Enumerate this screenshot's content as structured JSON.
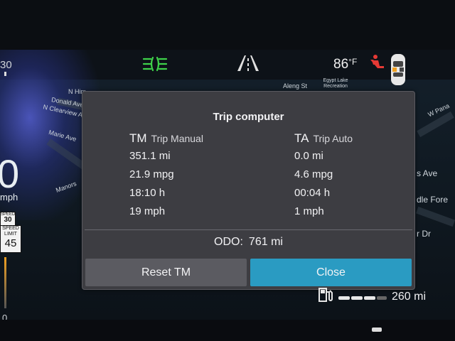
{
  "status": {
    "time_partial": "30",
    "temperature_value": "86",
    "temperature_unit": "°F"
  },
  "map": {
    "streets": [
      "N Him",
      "Donald Ave",
      "N Clearview Ave",
      "Marie Ave",
      "Manors",
      "Aleng St",
      "Egypt Lake Recreation",
      "W Pana",
      "s Ave",
      "dle Fore",
      "r Dr"
    ]
  },
  "left_cluster": {
    "speed_value": "0",
    "speed_unit": "mph",
    "sign_speed_label": "SPEED",
    "sign_speed_value": "30",
    "sign_limit_top": "SPEED",
    "sign_limit_mid": "LIMIT",
    "sign_limit_value": "45",
    "bottom_value": "0"
  },
  "trip_computer": {
    "title": "Trip computer",
    "manual": {
      "abbr": "TM",
      "label": "Trip Manual",
      "distance": "351.1 mi",
      "economy": "21.9 mpg",
      "duration": "18:10 h",
      "avg_speed": "19 mph"
    },
    "auto": {
      "abbr": "TA",
      "label": "Trip Auto",
      "distance": "0.0 mi",
      "economy": "4.6 mpg",
      "duration": "00:04 h",
      "avg_speed": "1 mph"
    },
    "odo_label": "ODO:",
    "odo_value": "761 mi",
    "reset_label": "Reset TM",
    "close_label": "Close"
  },
  "fuel": {
    "range": "260 mi"
  },
  "colors": {
    "headlight_indicator": "#3fd24a",
    "seatbelt_warning": "#e53935",
    "close_button": "#2a9bc2"
  },
  "icons": [
    "headlight-indicator-icon",
    "lane-assist-icon",
    "seatbelt-warning-icon",
    "vehicle-top-view-icon",
    "fuel-pump-icon"
  ]
}
